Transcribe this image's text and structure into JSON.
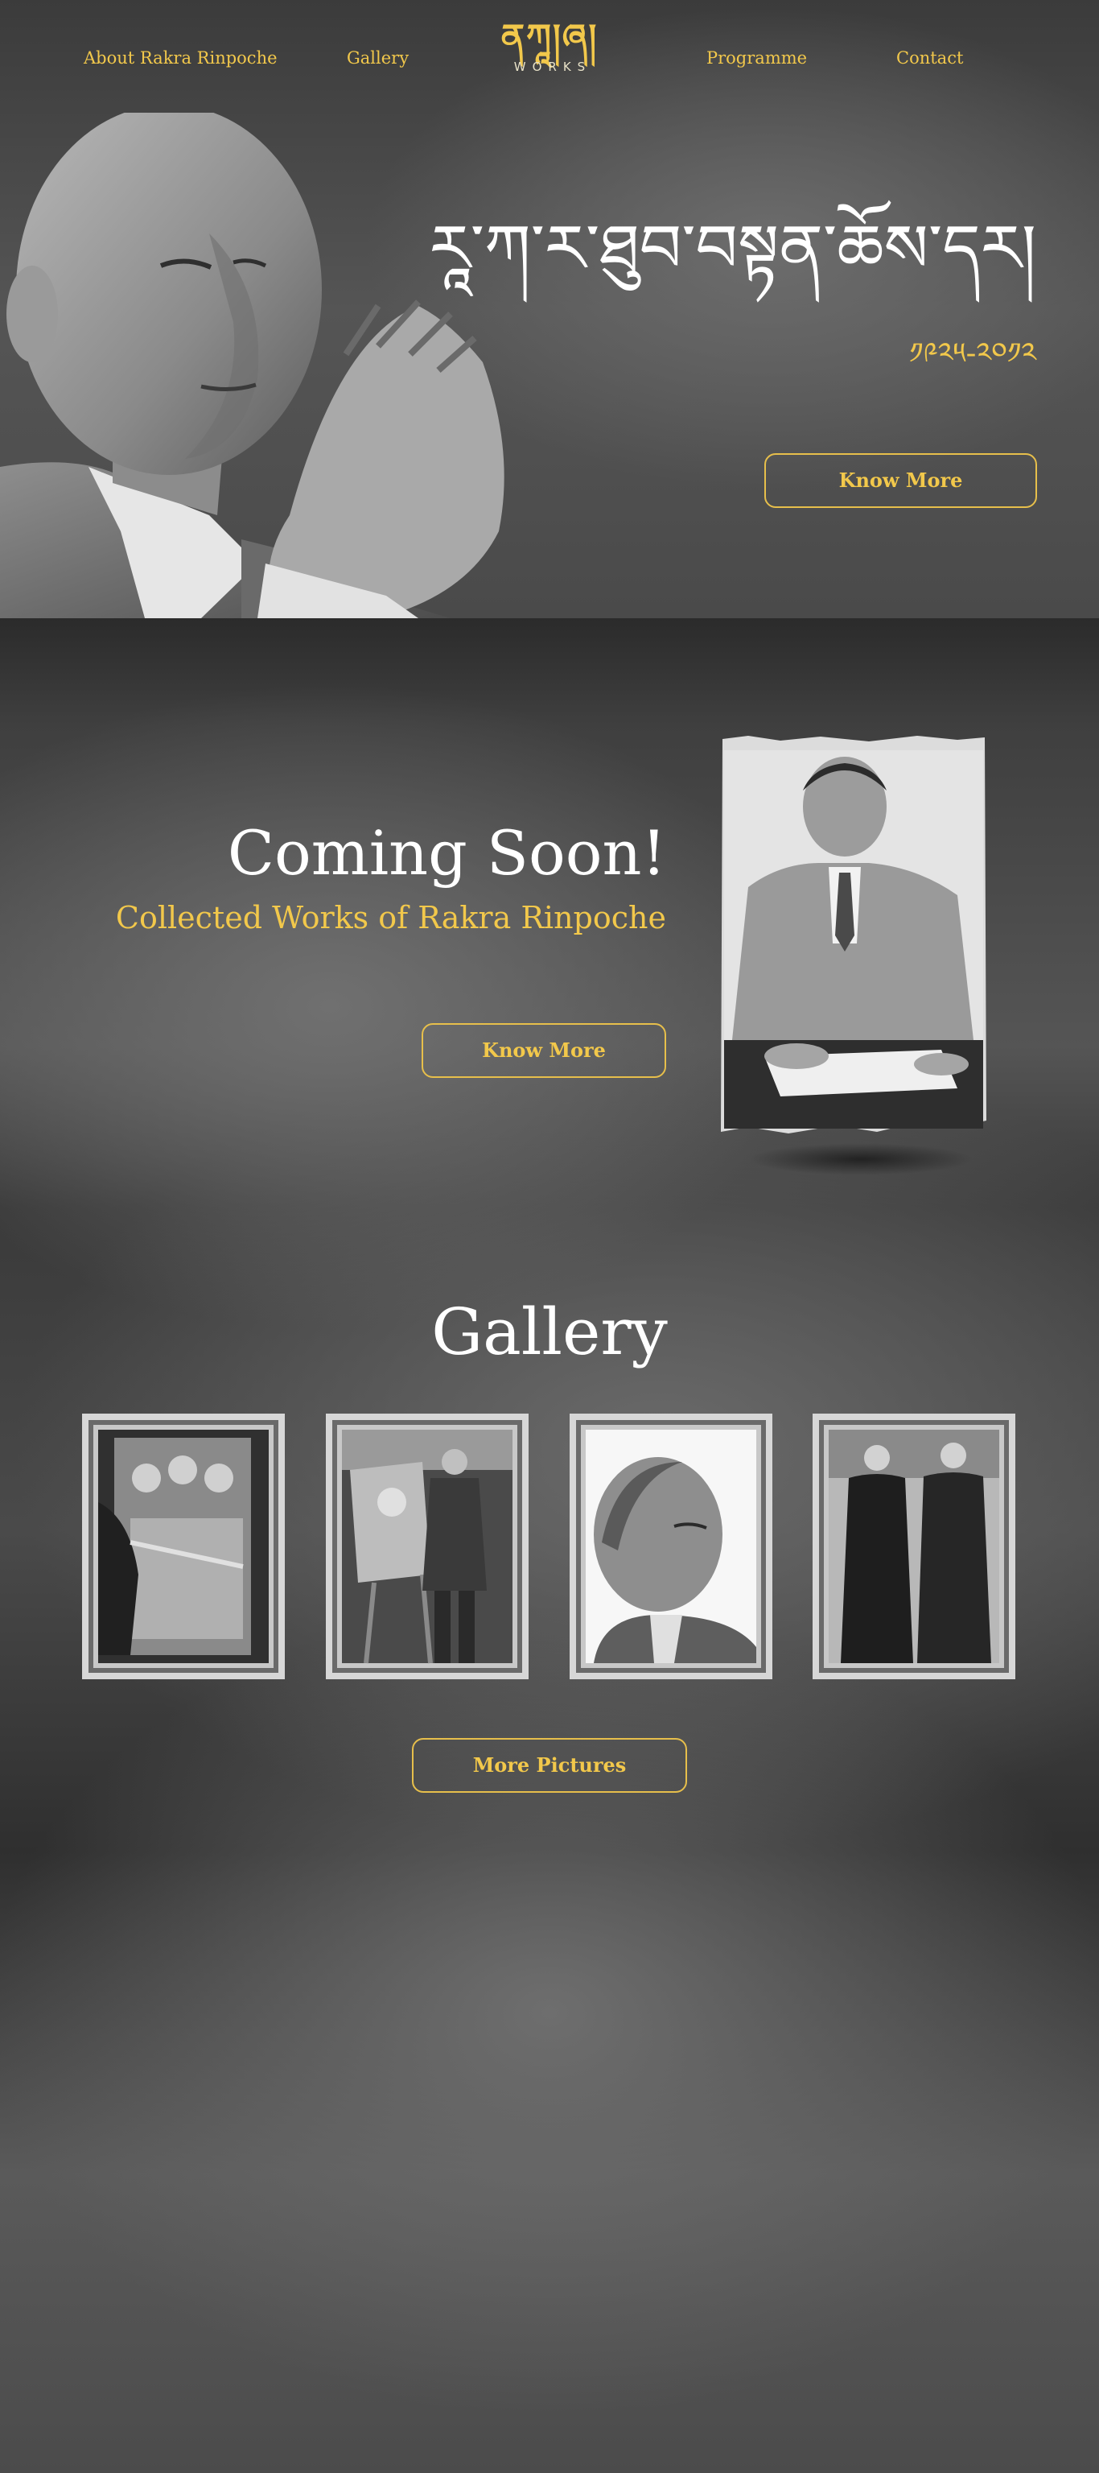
{
  "nav": {
    "about": "About Rakra Rinpoche",
    "gallery": "Gallery",
    "programme": "Programme",
    "contact": "Contact",
    "logo_mark": "ནཀཱ།ཞ།",
    "logo_sub": "WORKS"
  },
  "hero": {
    "title": "རཱ་ཀ་ར་ཐུབ་བསྟན་ཆོས་དར།",
    "years": "༡༩༢༥-༢༠༡༢",
    "button": "Know More"
  },
  "coming_soon": {
    "title": "Coming Soon!",
    "subtitle": "Collected Works of Rakra Rinpoche",
    "button": "Know More"
  },
  "gallery": {
    "title": "Gallery",
    "button": "More Pictures"
  },
  "colors": {
    "accent": "#f2c84b",
    "text": "#ffffff",
    "background": "#3a3a3a"
  }
}
